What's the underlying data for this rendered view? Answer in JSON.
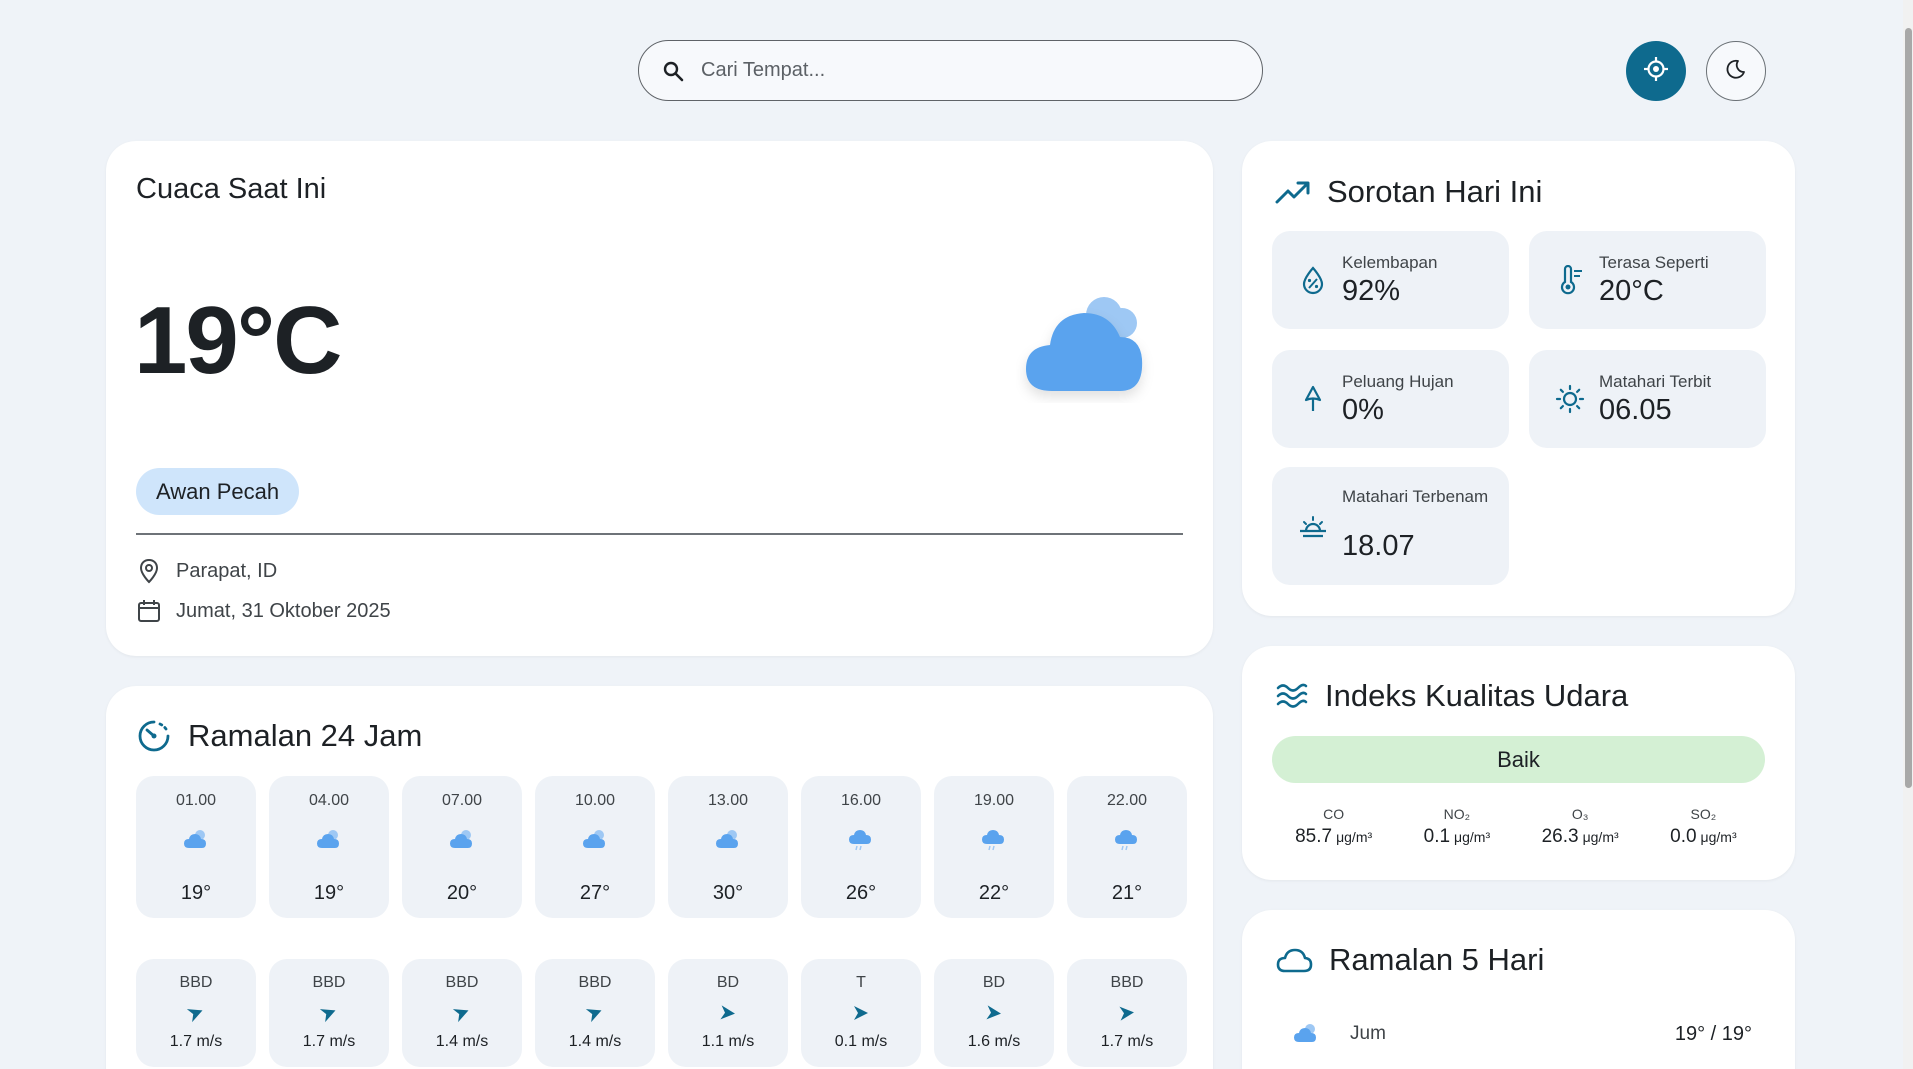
{
  "search": {
    "placeholder": "Cari Tempat..."
  },
  "colors": {
    "accent": "#0e6a8e",
    "cloud": "#5aa3ee",
    "chip": "#cfe5fb",
    "aqi_good": "#d4f0d4"
  },
  "current": {
    "title": "Cuaca Saat Ini",
    "temperature": "19°C",
    "condition": "Awan Pecah",
    "condition_icon": "broken-clouds-icon",
    "location": "Parapat, ID",
    "date": "Jumat, 31 Oktober 2025"
  },
  "hourly": {
    "title": "Ramalan 24 Jam",
    "temps": [
      {
        "time": "01.00",
        "temp": "19°",
        "icon": "cloud-icon"
      },
      {
        "time": "04.00",
        "temp": "19°",
        "icon": "cloud-icon"
      },
      {
        "time": "07.00",
        "temp": "20°",
        "icon": "cloud-icon"
      },
      {
        "time": "10.00",
        "temp": "27°",
        "icon": "cloud-icon"
      },
      {
        "time": "13.00",
        "temp": "30°",
        "icon": "cloud-icon"
      },
      {
        "time": "16.00",
        "temp": "26°",
        "icon": "light-rain-icon"
      },
      {
        "time": "19.00",
        "temp": "22°",
        "icon": "light-rain-icon"
      },
      {
        "time": "22.00",
        "temp": "21°",
        "icon": "light-rain-icon"
      }
    ],
    "wind": [
      {
        "dir": "BBD",
        "speed": "1.7 m/s"
      },
      {
        "dir": "BBD",
        "speed": "1.7 m/s"
      },
      {
        "dir": "BBD",
        "speed": "1.4 m/s"
      },
      {
        "dir": "BBD",
        "speed": "1.4 m/s"
      },
      {
        "dir": "BD",
        "speed": "1.1 m/s"
      },
      {
        "dir": "T",
        "speed": "0.1 m/s"
      },
      {
        "dir": "BD",
        "speed": "1.6 m/s"
      },
      {
        "dir": "BBD",
        "speed": "1.7 m/s"
      }
    ]
  },
  "highlights": {
    "title": "Sorotan Hari Ini",
    "humidity": {
      "label": "Kelembapan",
      "value": "92%"
    },
    "feels_like": {
      "label": "Terasa Seperti",
      "value": "20°C"
    },
    "rain_chance": {
      "label": "Peluang Hujan",
      "value": "0%"
    },
    "sunrise": {
      "label": "Matahari Terbit",
      "value": "06.05"
    },
    "sunset": {
      "label": "Matahari Terbenam",
      "value": "18.07"
    }
  },
  "aqi": {
    "title": "Indeks Kualitas Udara",
    "status": "Baik",
    "pollutants": [
      {
        "name": "CO",
        "value": "85.7",
        "unit": "μg/m³"
      },
      {
        "name": "NO₂",
        "value": "0.1",
        "unit": "μg/m³"
      },
      {
        "name": "O₃",
        "value": "26.3",
        "unit": "μg/m³"
      },
      {
        "name": "SO₂",
        "value": "0.0",
        "unit": "μg/m³"
      }
    ]
  },
  "forecast5": {
    "title": "Ramalan 5 Hari",
    "rows": [
      {
        "day": "Jum",
        "range": "19° / 19°",
        "icon": "cloud-icon"
      }
    ]
  }
}
